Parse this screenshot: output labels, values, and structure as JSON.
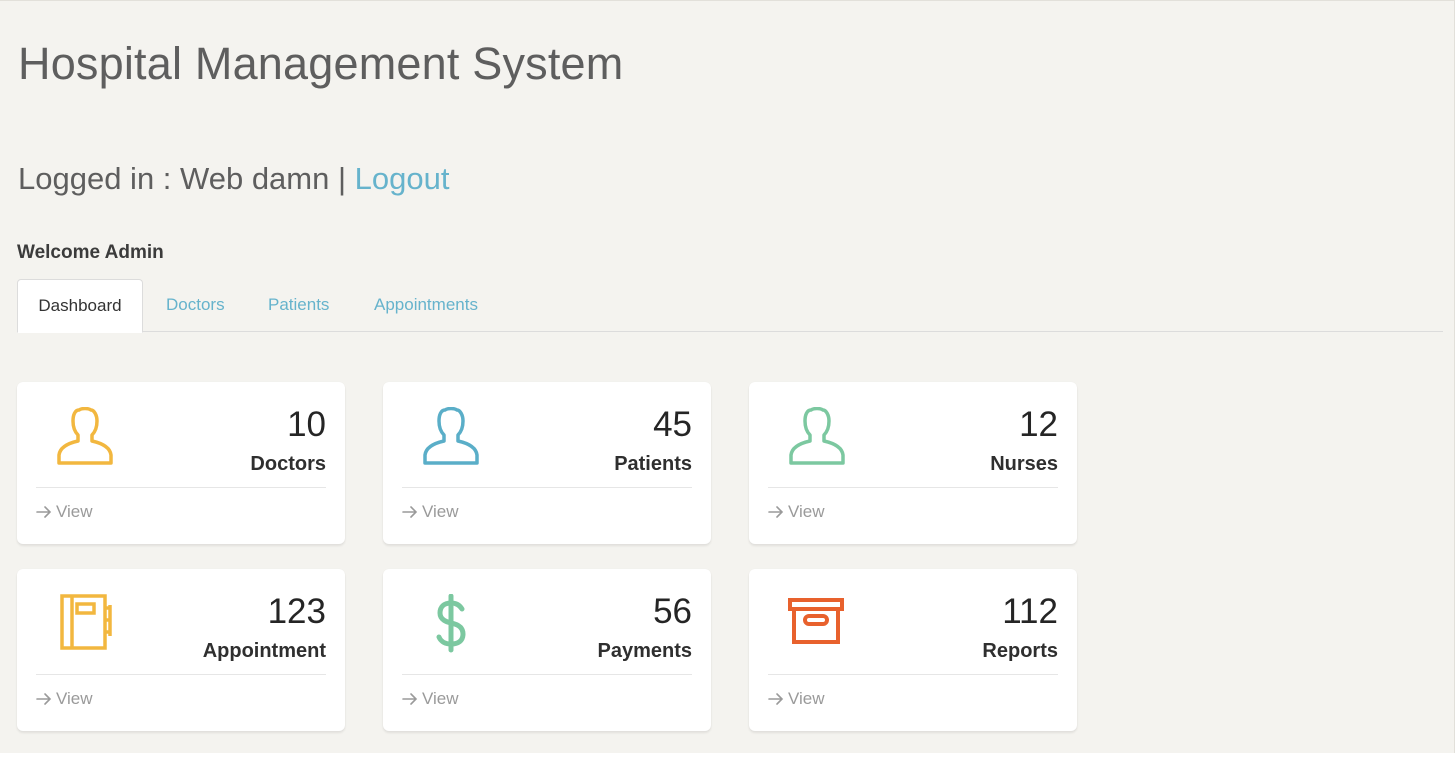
{
  "app": {
    "title": "Hospital Management System"
  },
  "session": {
    "logged_in_prefix": "Logged in : Web damn | ",
    "logout_label": "Logout",
    "welcome": "Welcome Admin"
  },
  "tabs": [
    {
      "label": "Dashboard",
      "active": true
    },
    {
      "label": "Doctors",
      "active": false
    },
    {
      "label": "Patients",
      "active": false
    },
    {
      "label": "Appointments",
      "active": false
    }
  ],
  "cards": [
    {
      "number": "10",
      "label": "Doctors",
      "link": "View",
      "icon": "person-icon",
      "color": "#f2b73f"
    },
    {
      "number": "45",
      "label": "Patients",
      "link": "View",
      "icon": "person-icon",
      "color": "#5aaec8"
    },
    {
      "number": "12",
      "label": "Nurses",
      "link": "View",
      "icon": "person-icon",
      "color": "#7cc8a0"
    },
    {
      "number": "123",
      "label": "Appointment",
      "link": "View",
      "icon": "notebook-icon",
      "color": "#f2b73f"
    },
    {
      "number": "56",
      "label": "Payments",
      "link": "View",
      "icon": "dollar-icon",
      "color": "#7cc8a0"
    },
    {
      "number": "112",
      "label": "Reports",
      "link": "View",
      "icon": "archive-box-icon",
      "color": "#e8612d"
    }
  ]
}
